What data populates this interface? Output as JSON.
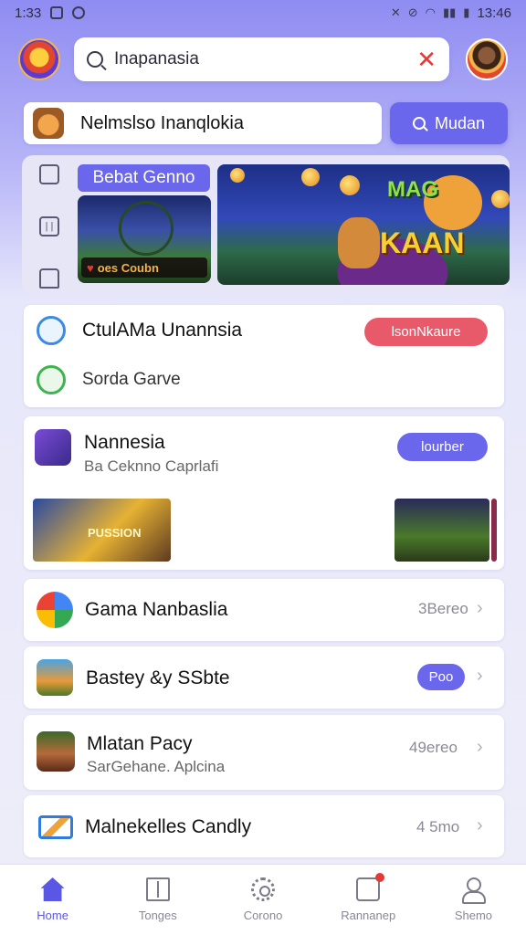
{
  "status_bar": {
    "time_left": "1:33",
    "time_right": "13:46"
  },
  "search": {
    "value": "Inapanasia"
  },
  "secondary_field": {
    "text": "Nelmslso Inanqlokia"
  },
  "search_button": {
    "label": "Mudan"
  },
  "banner": {
    "pill_title": "Bebat Genno",
    "thumb_caption": "oes Coubn",
    "game_title_top": "MAG",
    "game_title_main": "KAAN"
  },
  "card_a": {
    "row1": {
      "title": "CtulAMa Unannsia",
      "pill": "lsonNkaure"
    },
    "row2": {
      "title": "Sorda Garve"
    }
  },
  "card_b": {
    "title": "Nannesia",
    "subtitle": "Ba Ceknno Caprlafi",
    "pill": "lourber",
    "shot_caption": "PUSSION"
  },
  "list": [
    {
      "title": "Gama Nanbaslia",
      "value": "3Bereo"
    },
    {
      "title": "Bastey &y SSbte",
      "badge": "Poo"
    },
    {
      "title": "Mlatan Pacy",
      "subtitle": "SarGehane. Aplcina",
      "value": "49ereo"
    },
    {
      "title": "Malnekelles Candly",
      "value": "4 5mo"
    }
  ],
  "nav": [
    {
      "label": "Home",
      "icon": "home-icon"
    },
    {
      "label": "Tonges",
      "icon": "book-icon"
    },
    {
      "label": "Corono",
      "icon": "gear-icon"
    },
    {
      "label": "Rannanep",
      "icon": "bag-icon"
    },
    {
      "label": "Shemo",
      "icon": "user-icon"
    }
  ],
  "colors": {
    "accent": "#6a67ec",
    "danger": "#e85a6a",
    "nav_active": "#5a57e4"
  }
}
